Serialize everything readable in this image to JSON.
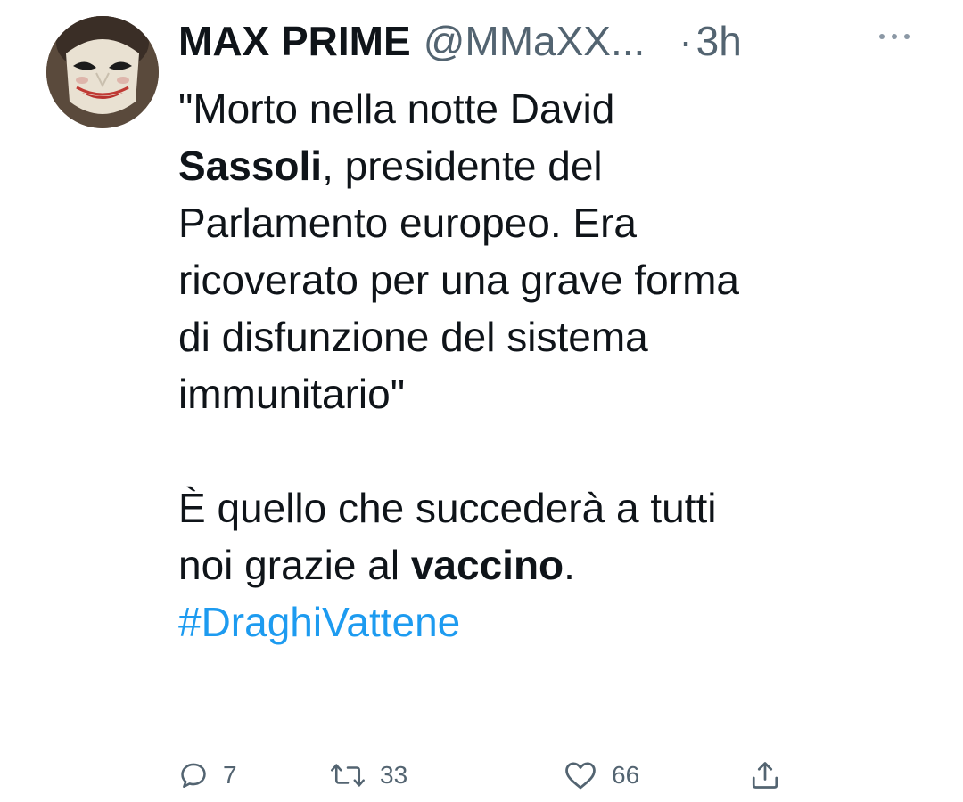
{
  "tweet": {
    "display_name": "MAX PRIME",
    "handle": "@MMaXX...",
    "separator": "·",
    "time": "3h",
    "body": {
      "line1": "\"Morto nella notte David",
      "line2_bold": "Sassoli",
      "line2_rest": ", presidente del",
      "line3": "Parlamento europeo. Era",
      "line4": "ricoverato per una grave forma",
      "line5": "di disfunzione del sistema",
      "line6": "immunitario\"",
      "line7": "È quello che succederà a tutti",
      "line8_pre": "noi grazie al ",
      "line8_bold": "vaccino",
      "line8_post": ".",
      "hashtag": "#DraghiVattene"
    },
    "actions": {
      "replies": "7",
      "retweets": "33",
      "likes": "66"
    }
  },
  "icons": {
    "avatar": "masked-face-avatar",
    "more": "more-dots-icon",
    "reply": "reply-icon",
    "retweet": "retweet-icon",
    "like": "heart-icon",
    "share": "share-icon"
  },
  "colors": {
    "text": "#0f1419",
    "secondary": "#536471",
    "link": "#1d9bf0",
    "background": "#ffffff"
  }
}
